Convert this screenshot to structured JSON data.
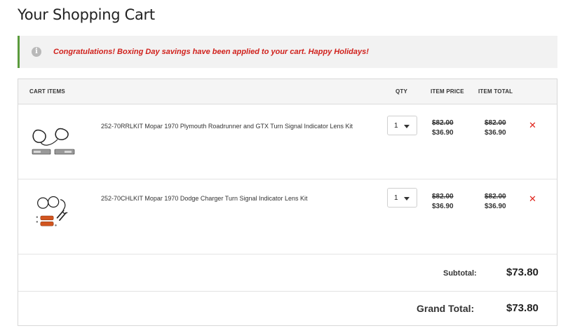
{
  "page": {
    "title": "Your Shopping Cart"
  },
  "alert": {
    "icon": "info-icon",
    "message": "Congratulations! Boxing Day savings have been applied to your cart. Happy Holidays!"
  },
  "table": {
    "headers": {
      "items": "CART ITEMS",
      "qty": "QTY",
      "price": "ITEM PRICE",
      "total": "ITEM TOTAL"
    }
  },
  "items": [
    {
      "name": "252-70RRLKIT Mopar 1970 Plymouth Roadrunner and GTX Turn Signal Indicator Lens Kit",
      "qty": "1",
      "price_old": "$82.00",
      "price_new": "$36.90",
      "total_old": "$82.00",
      "total_new": "$36.90",
      "remove": "✕"
    },
    {
      "name": "252-70CHLKIT Mopar 1970 Dodge Charger Turn Signal Indicator Lens Kit",
      "qty": "1",
      "price_old": "$82.00",
      "price_new": "$36.90",
      "total_old": "$82.00",
      "total_new": "$36.90",
      "remove": "✕"
    }
  ],
  "summary": {
    "subtotal_label": "Subtotal:",
    "subtotal_value": "$73.80",
    "grand_total_label": "Grand Total:",
    "grand_total_value": "$73.80"
  },
  "colors": {
    "accent_green": "#5a9b3c",
    "alert_red": "#d0201b",
    "remove_red": "#e0241c"
  }
}
